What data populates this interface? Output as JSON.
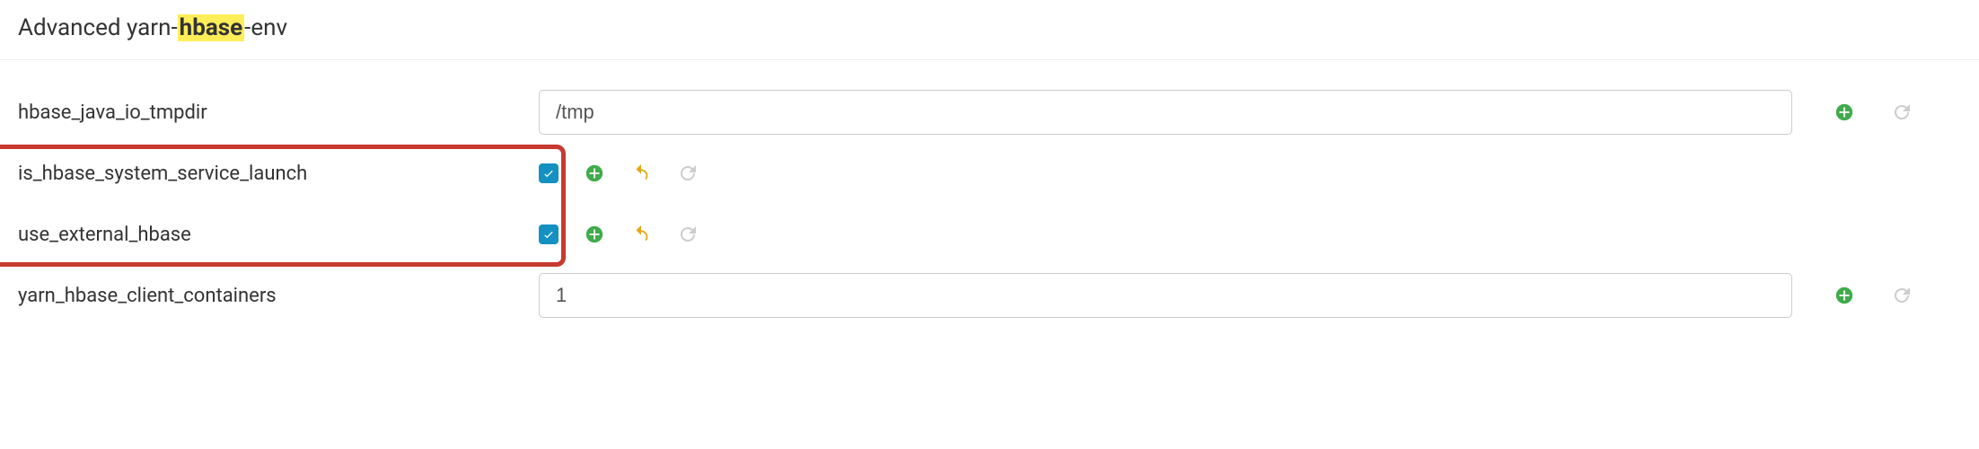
{
  "section": {
    "title_prefix": "Advanced yarn-",
    "title_highlight": "hbase",
    "title_suffix": "-env"
  },
  "rows": {
    "tmpdir": {
      "label": "hbase_java_io_tmpdir",
      "value": "/tmp"
    },
    "system_launch": {
      "label": "is_hbase_system_service_launch",
      "checked": true
    },
    "external_hbase": {
      "label": "use_external_hbase",
      "checked": true
    },
    "client_containers": {
      "label": "yarn_hbase_client_containers",
      "value": "1"
    }
  }
}
